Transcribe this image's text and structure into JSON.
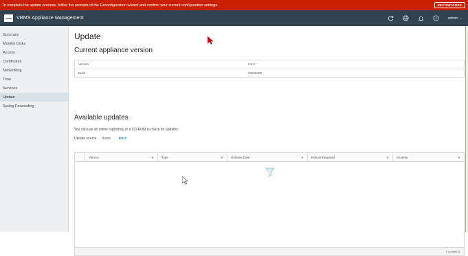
{
  "alert": {
    "message": "To complete the update process, follow the prompts of the Reconfiguration wizard and confirm your current configuration settings.",
    "button": "RECONFIGURE",
    "color": "#c92100"
  },
  "header": {
    "logo": "vmw",
    "title": "VRMS Appliance Management",
    "icons": [
      "refresh-icon",
      "globe-icon",
      "bell-icon",
      "help-icon"
    ],
    "user": "admin",
    "bg": "#314351"
  },
  "sidebar": {
    "items": [
      {
        "label": "Summary"
      },
      {
        "label": "Monitor Disks"
      },
      {
        "label": "Access"
      },
      {
        "label": "Certificates"
      },
      {
        "label": "Networking"
      },
      {
        "label": "Time"
      },
      {
        "label": "Services"
      },
      {
        "label": "Update",
        "active": true
      },
      {
        "label": "Syslog Forwarding"
      }
    ]
  },
  "main": {
    "title": "Update",
    "current_heading": "Current appliance version",
    "version_table": [
      {
        "key": "Version",
        "value": "8.8.0"
      },
      {
        "key": "Build",
        "value": "20265408"
      }
    ],
    "available_heading": "Available updates",
    "description": "You can use an online repository or a CD-ROM to check for updates.",
    "update_source_label": "Update source",
    "update_source_value": "/none",
    "edit_label": "EDIT",
    "grid": {
      "columns": [
        "Version",
        "Type",
        "Release Date",
        "Reboot Required",
        "Severity"
      ],
      "footer": "0 update(s)"
    }
  }
}
